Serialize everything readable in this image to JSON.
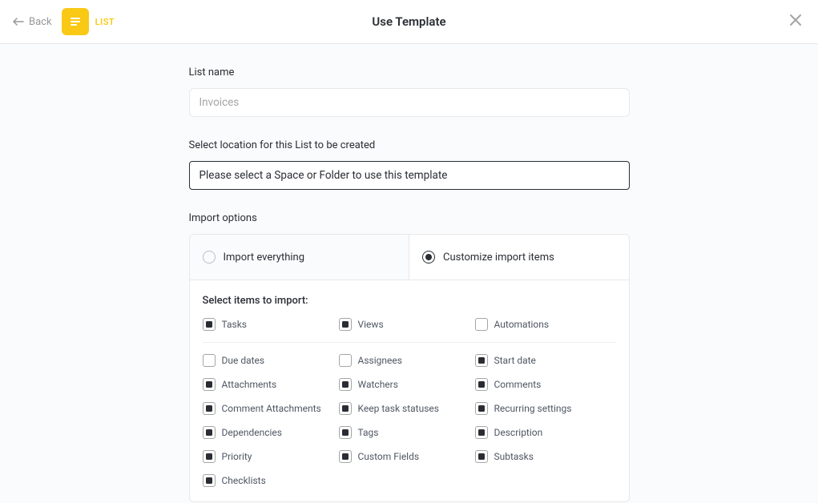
{
  "header": {
    "back_label": "Back",
    "badge_text": "LIST",
    "title": "Use Template"
  },
  "form": {
    "name_label": "List name",
    "name_placeholder": "Invoices",
    "location_label": "Select location for this List to be created",
    "location_placeholder": "Please select a Space or Folder to use this template",
    "import_options_label": "Import options",
    "import_everything_label": "Import everything",
    "customize_label": "Customize import items",
    "select_items_label": "Select items to import:"
  },
  "top_items": [
    {
      "label": "Tasks",
      "checked": true
    },
    {
      "label": "Views",
      "checked": true
    },
    {
      "label": "Automations",
      "checked": false
    }
  ],
  "grid_items": [
    {
      "label": "Due dates",
      "checked": false
    },
    {
      "label": "Assignees",
      "checked": false
    },
    {
      "label": "Start date",
      "checked": true
    },
    {
      "label": "Attachments",
      "checked": true
    },
    {
      "label": "Watchers",
      "checked": true
    },
    {
      "label": "Comments",
      "checked": true
    },
    {
      "label": "Comment Attachments",
      "checked": true
    },
    {
      "label": "Keep task statuses",
      "checked": true
    },
    {
      "label": "Recurring settings",
      "checked": true
    },
    {
      "label": "Dependencies",
      "checked": true
    },
    {
      "label": "Tags",
      "checked": true
    },
    {
      "label": "Description",
      "checked": true
    },
    {
      "label": "Priority",
      "checked": true
    },
    {
      "label": "Custom Fields",
      "checked": true
    },
    {
      "label": "Subtasks",
      "checked": true
    },
    {
      "label": "Checklists",
      "checked": true
    }
  ]
}
